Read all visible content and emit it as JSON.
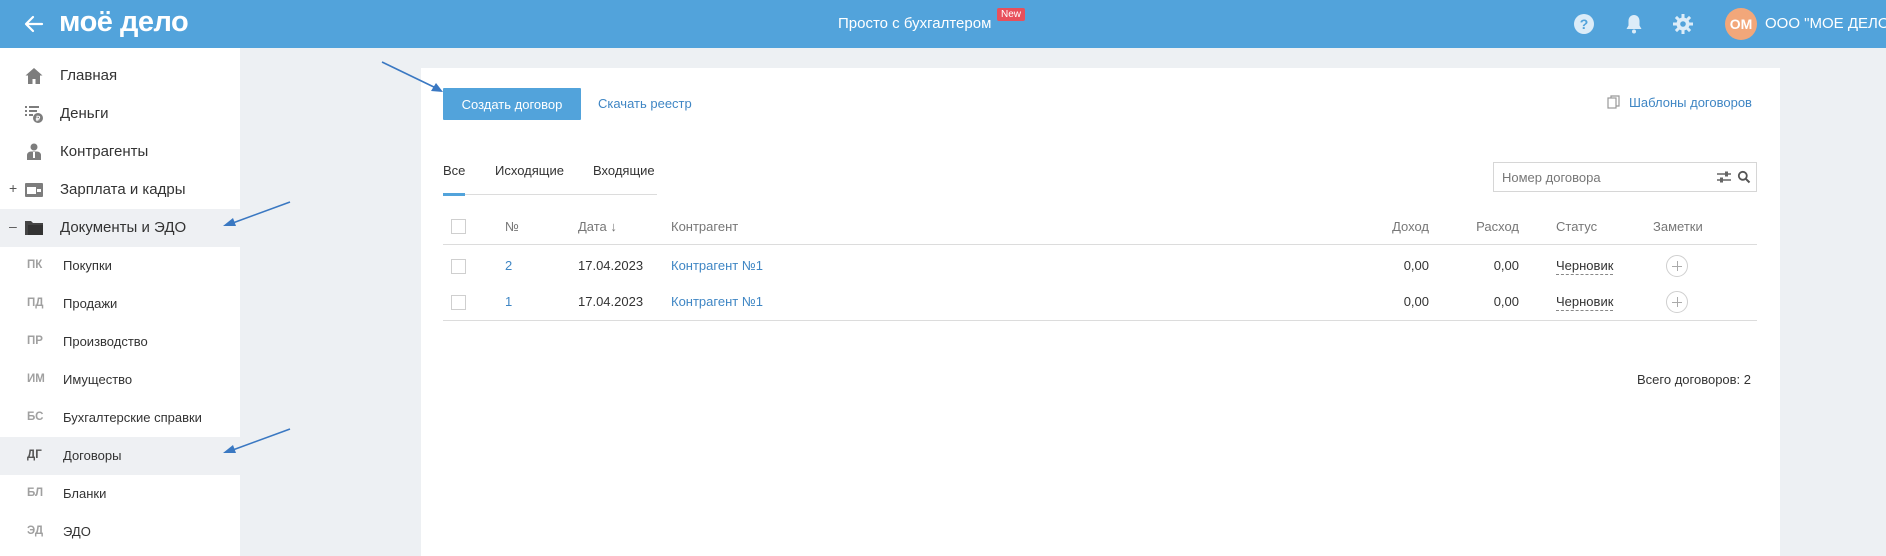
{
  "header": {
    "logo": "моё дело",
    "center_title": "Просто с бухгалтером",
    "new_badge": "New",
    "avatar_initials": "ОМ",
    "company": "ООО \"МОЕ ДЕЛО\""
  },
  "sidebar": {
    "items": [
      {
        "label": "Главная",
        "icon": "home-icon"
      },
      {
        "label": "Деньги",
        "icon": "money-icon"
      },
      {
        "label": "Контрагенты",
        "icon": "contractors-icon"
      },
      {
        "label": "Зарплата и кадры",
        "icon": "wallet-icon",
        "toggle": "+"
      },
      {
        "label": "Документы и ЭДО",
        "icon": "folder-icon",
        "toggle": "–"
      }
    ],
    "sub_items": [
      {
        "code": "ПК",
        "label": "Покупки"
      },
      {
        "code": "ПД",
        "label": "Продажи"
      },
      {
        "code": "ПР",
        "label": "Производство"
      },
      {
        "code": "ИМ",
        "label": "Имущество"
      },
      {
        "code": "БС",
        "label": "Бухгалтерские справки"
      },
      {
        "code": "ДГ",
        "label": "Договоры"
      },
      {
        "code": "БЛ",
        "label": "Бланки"
      },
      {
        "code": "ЭД",
        "label": "ЭДО"
      }
    ]
  },
  "toolbar": {
    "create_label": "Создать договор",
    "registry_label": "Скачать реестр",
    "templates_label": "Шаблоны договоров"
  },
  "tabs": [
    "Все",
    "Исходящие",
    "Входящие"
  ],
  "search": {
    "placeholder": "Номер договора"
  },
  "table": {
    "headers": {
      "number": "№",
      "date": "Дата ↓",
      "contractor": "Контрагент",
      "income": "Доход",
      "expense": "Расход",
      "status": "Статус",
      "notes": "Заметки"
    },
    "rows": [
      {
        "number": "2",
        "date": "17.04.2023",
        "contractor": "Контрагент №1",
        "income": "0,00",
        "expense": "0,00",
        "status": "Черновик"
      },
      {
        "number": "1",
        "date": "17.04.2023",
        "contractor": "Контрагент №1",
        "income": "0,00",
        "expense": "0,00",
        "status": "Черновик"
      }
    ]
  },
  "total_label": "Всего договоров: 2",
  "colors": {
    "header_bg": "#52a3db",
    "accent": "#52a3db",
    "link": "#3f86c4",
    "badge": "#e8505b",
    "annotation_arrow": "#3a78c2"
  }
}
